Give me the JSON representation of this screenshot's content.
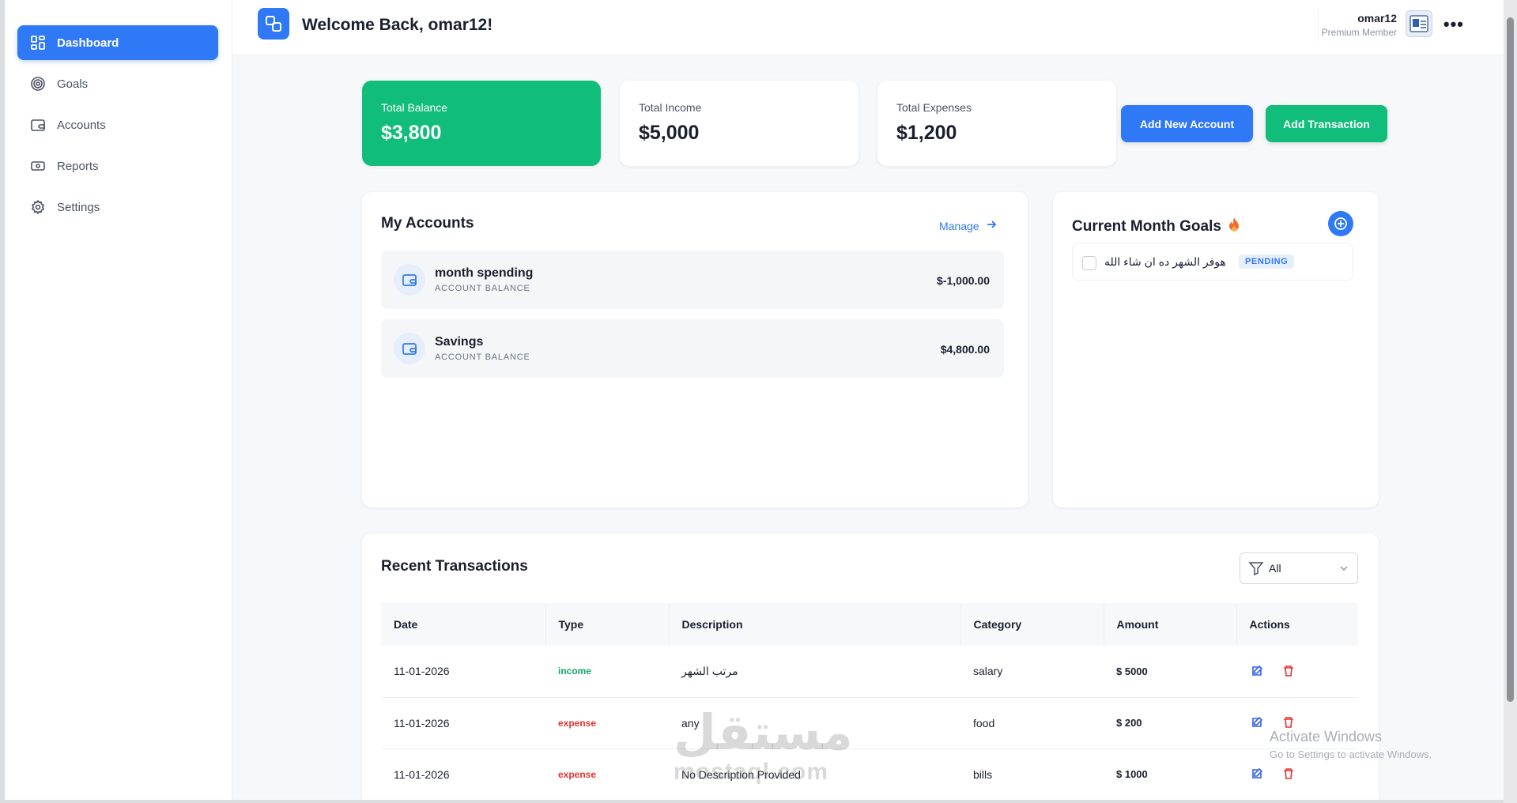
{
  "sidebar": {
    "items": [
      {
        "label": "Dashboard",
        "icon": "dashboard-icon",
        "active": true
      },
      {
        "label": "Goals",
        "icon": "target-icon"
      },
      {
        "label": "Accounts",
        "icon": "wallet-icon"
      },
      {
        "label": "Reports",
        "icon": "banknote-icon"
      },
      {
        "label": "Settings",
        "icon": "gear-icon"
      }
    ]
  },
  "header": {
    "welcome": "Welcome Back, omar12!",
    "user_name": "omar12",
    "user_role": "Premium Member"
  },
  "stats": {
    "balance_label": "Total Balance",
    "balance_value": "$3,800",
    "income_label": "Total Income",
    "income_value": "$5,000",
    "expenses_label": "Total Expenses",
    "expenses_value": "$1,200"
  },
  "actions": {
    "add_account": "Add New Account",
    "add_transaction": "Add Transaction"
  },
  "accounts": {
    "title": "My Accounts",
    "manage": "Manage",
    "items": [
      {
        "name": "month spending",
        "sub": "ACCOUNT BALANCE",
        "balance": "$-1,000.00"
      },
      {
        "name": "Savings",
        "sub": "ACCOUNT BALANCE",
        "balance": "$4,800.00"
      }
    ]
  },
  "goals": {
    "title": "Current Month Goals",
    "items": [
      {
        "text": "هوفر الشهر ده ان شاء الله",
        "status": "PENDING"
      }
    ]
  },
  "transactions": {
    "title": "Recent Transactions",
    "filter": "All",
    "columns": [
      "Date",
      "Type",
      "Description",
      "Category",
      "Amount",
      "Actions"
    ],
    "rows": [
      {
        "date": "11-01-2026",
        "type": "income",
        "description": "مرتب الشهر",
        "category": "salary",
        "amount": "$ 5000"
      },
      {
        "date": "11-01-2026",
        "type": "expense",
        "description": "any",
        "category": "food",
        "amount": "$ 200"
      },
      {
        "date": "11-01-2026",
        "type": "expense",
        "description": "No Description Provided",
        "category": "bills",
        "amount": "$ 1000"
      }
    ]
  },
  "overlay": {
    "watermark": "مستقل",
    "watermark_sub": "mostaql.com",
    "activate_title": "Activate Windows",
    "activate_sub": "Go to Settings to activate Windows."
  },
  "colors": {
    "primary": "#2f78f6",
    "success": "#10bd7a",
    "danger": "#e3342f"
  }
}
